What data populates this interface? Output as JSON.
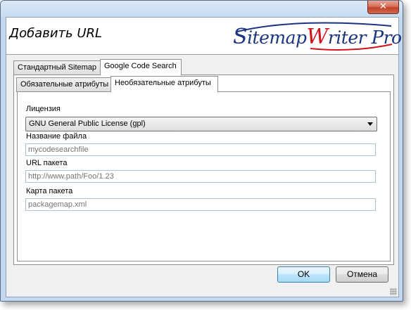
{
  "window": {
    "close_label": "✕"
  },
  "header": {
    "title": "Добавить URL",
    "logo": {
      "part1": "itemap",
      "part2": "riter",
      "part3": "ro",
      "s": "S",
      "w": "W",
      "p": "P"
    }
  },
  "outer_tabs": [
    {
      "label": "Стандартный Sitemap"
    },
    {
      "label": "Google Code Search"
    }
  ],
  "inner_tabs": [
    {
      "label": "Обязательные атрибуты"
    },
    {
      "label": "Необязательные атрибуты"
    }
  ],
  "form": {
    "license_label": "Лицензия",
    "license_value": "GNU General Public License (gpl)",
    "filename_label": "Название файла",
    "filename_placeholder": "mycodesearchfile",
    "package_url_label": "URL пакета",
    "package_url_placeholder": "http://www.path/Foo/1.23",
    "package_map_label": "Карта пакета",
    "package_map_placeholder": "packagemap.xml"
  },
  "buttons": {
    "ok": "OK",
    "cancel": "Отмена"
  }
}
